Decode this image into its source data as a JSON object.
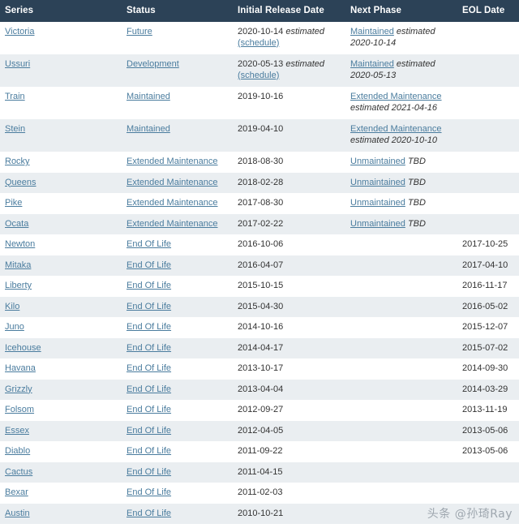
{
  "table": {
    "columns": [
      {
        "key": "series",
        "label": "Series"
      },
      {
        "key": "status",
        "label": "Status"
      },
      {
        "key": "initial",
        "label": "Initial Release Date"
      },
      {
        "key": "next",
        "label": "Next Phase"
      },
      {
        "key": "eol",
        "label": "EOL Date"
      }
    ],
    "rows": [
      {
        "series": "Victoria",
        "status": "Future",
        "initial_date": "2020-10-14",
        "initial_estimated": "estimated",
        "initial_schedule_link": "(schedule)",
        "next_phase": "Maintained",
        "next_estimated": "estimated",
        "next_date": "2020-10-14",
        "eol": ""
      },
      {
        "series": "Ussuri",
        "status": "Development",
        "initial_date": "2020-05-13",
        "initial_estimated": "estimated",
        "initial_schedule_link": "(schedule)",
        "next_phase": "Maintained",
        "next_estimated": "estimated",
        "next_date": "2020-05-13",
        "eol": ""
      },
      {
        "series": "Train",
        "status": "Maintained",
        "initial_date": "2019-10-16",
        "initial_estimated": "",
        "initial_schedule_link": "",
        "next_phase": "Extended Maintenance",
        "next_estimated": "estimated",
        "next_date": "2021-04-16",
        "eol": ""
      },
      {
        "series": "Stein",
        "status": "Maintained",
        "initial_date": "2019-04-10",
        "initial_estimated": "",
        "initial_schedule_link": "",
        "next_phase": "Extended Maintenance",
        "next_estimated": "estimated",
        "next_date": "2020-10-10",
        "eol": ""
      },
      {
        "series": "Rocky",
        "status": "Extended Maintenance",
        "initial_date": "2018-08-30",
        "initial_estimated": "",
        "initial_schedule_link": "",
        "next_phase": "Unmaintained",
        "next_estimated": "TBD",
        "next_date": "",
        "eol": ""
      },
      {
        "series": "Queens",
        "status": "Extended Maintenance",
        "initial_date": "2018-02-28",
        "initial_estimated": "",
        "initial_schedule_link": "",
        "next_phase": "Unmaintained",
        "next_estimated": "TBD",
        "next_date": "",
        "eol": ""
      },
      {
        "series": "Pike",
        "status": "Extended Maintenance",
        "initial_date": "2017-08-30",
        "initial_estimated": "",
        "initial_schedule_link": "",
        "next_phase": "Unmaintained",
        "next_estimated": "TBD",
        "next_date": "",
        "eol": ""
      },
      {
        "series": "Ocata",
        "status": "Extended Maintenance",
        "initial_date": "2017-02-22",
        "initial_estimated": "",
        "initial_schedule_link": "",
        "next_phase": "Unmaintained",
        "next_estimated": "TBD",
        "next_date": "",
        "eol": ""
      },
      {
        "series": "Newton",
        "status": "End Of Life",
        "initial_date": "2016-10-06",
        "initial_estimated": "",
        "initial_schedule_link": "",
        "next_phase": "",
        "next_estimated": "",
        "next_date": "",
        "eol": "2017-10-25"
      },
      {
        "series": "Mitaka",
        "status": "End Of Life",
        "initial_date": "2016-04-07",
        "initial_estimated": "",
        "initial_schedule_link": "",
        "next_phase": "",
        "next_estimated": "",
        "next_date": "",
        "eol": "2017-04-10"
      },
      {
        "series": "Liberty",
        "status": "End Of Life",
        "initial_date": "2015-10-15",
        "initial_estimated": "",
        "initial_schedule_link": "",
        "next_phase": "",
        "next_estimated": "",
        "next_date": "",
        "eol": "2016-11-17"
      },
      {
        "series": "Kilo",
        "status": "End Of Life",
        "initial_date": "2015-04-30",
        "initial_estimated": "",
        "initial_schedule_link": "",
        "next_phase": "",
        "next_estimated": "",
        "next_date": "",
        "eol": "2016-05-02"
      },
      {
        "series": "Juno",
        "status": "End Of Life",
        "initial_date": "2014-10-16",
        "initial_estimated": "",
        "initial_schedule_link": "",
        "next_phase": "",
        "next_estimated": "",
        "next_date": "",
        "eol": "2015-12-07"
      },
      {
        "series": "Icehouse",
        "status": "End Of Life",
        "initial_date": "2014-04-17",
        "initial_estimated": "",
        "initial_schedule_link": "",
        "next_phase": "",
        "next_estimated": "",
        "next_date": "",
        "eol": "2015-07-02"
      },
      {
        "series": "Havana",
        "status": "End Of Life",
        "initial_date": "2013-10-17",
        "initial_estimated": "",
        "initial_schedule_link": "",
        "next_phase": "",
        "next_estimated": "",
        "next_date": "",
        "eol": "2014-09-30"
      },
      {
        "series": "Grizzly",
        "status": "End Of Life",
        "initial_date": "2013-04-04",
        "initial_estimated": "",
        "initial_schedule_link": "",
        "next_phase": "",
        "next_estimated": "",
        "next_date": "",
        "eol": "2014-03-29"
      },
      {
        "series": "Folsom",
        "status": "End Of Life",
        "initial_date": "2012-09-27",
        "initial_estimated": "",
        "initial_schedule_link": "",
        "next_phase": "",
        "next_estimated": "",
        "next_date": "",
        "eol": "2013-11-19"
      },
      {
        "series": "Essex",
        "status": "End Of Life",
        "initial_date": "2012-04-05",
        "initial_estimated": "",
        "initial_schedule_link": "",
        "next_phase": "",
        "next_estimated": "",
        "next_date": "",
        "eol": "2013-05-06"
      },
      {
        "series": "Diablo",
        "status": "End Of Life",
        "initial_date": "2011-09-22",
        "initial_estimated": "",
        "initial_schedule_link": "",
        "next_phase": "",
        "next_estimated": "",
        "next_date": "",
        "eol": "2013-05-06"
      },
      {
        "series": "Cactus",
        "status": "End Of Life",
        "initial_date": "2011-04-15",
        "initial_estimated": "",
        "initial_schedule_link": "",
        "next_phase": "",
        "next_estimated": "",
        "next_date": "",
        "eol": ""
      },
      {
        "series": "Bexar",
        "status": "End Of Life",
        "initial_date": "2011-02-03",
        "initial_estimated": "",
        "initial_schedule_link": "",
        "next_phase": "",
        "next_estimated": "",
        "next_date": "",
        "eol": ""
      },
      {
        "series": "Austin",
        "status": "End Of Life",
        "initial_date": "2010-10-21",
        "initial_estimated": "",
        "initial_schedule_link": "",
        "next_phase": "",
        "next_estimated": "",
        "next_date": "",
        "eol": ""
      }
    ]
  },
  "watermark": {
    "text": "头条 @孙琦Ray"
  },
  "colors": {
    "header_bg": "#2c4257",
    "header_text": "#ffffff",
    "stripe_bg": "#eaeef1",
    "row_bg": "#ffffff",
    "link": "#4a7c9e",
    "text": "#333333"
  }
}
